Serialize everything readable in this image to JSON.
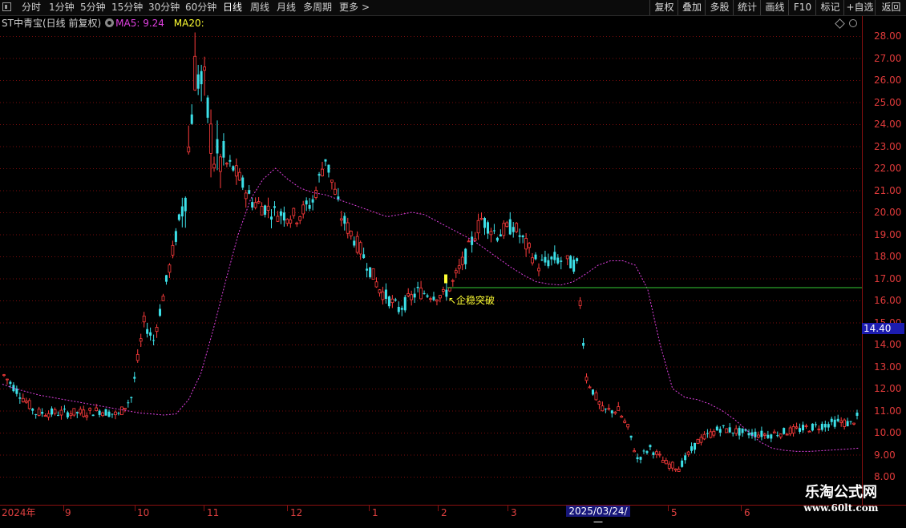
{
  "toolbar": {
    "periods": [
      "分时",
      "1分钟",
      "5分钟",
      "15分钟",
      "30分钟",
      "60分钟",
      "日线",
      "周线",
      "月线",
      "多周期",
      "更多"
    ],
    "active_period": "日线",
    "more_arrow": ">",
    "right_buttons": [
      "复权",
      "叠加",
      "多股",
      "统计",
      "画线",
      "F10",
      "标记",
      "+自选",
      "返回"
    ]
  },
  "info": {
    "title": "ST中青宝(日线 前复权)",
    "ma5_label": "MA5: 9.24",
    "ma20_label": "MA20:"
  },
  "colors": {
    "up": "#ff3c3c",
    "down": "#3ce0e8",
    "ma5": "#ffffff",
    "ma20": "#e040e0",
    "grid": "#7a0c0c",
    "signal_line": "#33cc33",
    "annotation": "#ffff33"
  },
  "price_axis": {
    "labels": [
      "28.00",
      "27.00",
      "26.00",
      "25.00",
      "24.00",
      "23.00",
      "22.00",
      "21.00",
      "20.00",
      "19.00",
      "18.00",
      "17.00",
      "16.00",
      "15.00",
      "14.00",
      "13.00",
      "12.00",
      "11.00",
      "10.00",
      "9.00",
      "8.00"
    ],
    "current_price_tag": "14.40"
  },
  "date_axis": {
    "labels": [
      "2024年",
      "9",
      "10",
      "11",
      "12",
      "1",
      "2",
      "3",
      "5",
      "6"
    ],
    "crosshair_date": "2025/03/24/一"
  },
  "annotation": "↖企稳突破",
  "watermark": {
    "line1": "乐淘公式网",
    "line2": "www.60lt.com"
  },
  "chart_data": {
    "type": "candlestick",
    "title": "ST中青宝(日线 前复权)",
    "ylim": [
      7.9,
      28.4
    ],
    "ma5_value": 9.24,
    "signal_level": 16.6,
    "signal_label": "企稳突破",
    "current_price": 14.4,
    "x_range": [
      "2024-08",
      "2025-06"
    ],
    "series": [
      {
        "name": "MA20",
        "values": [
          12.2,
          12.0,
          11.85,
          11.7,
          11.6,
          11.5,
          11.4,
          11.3,
          11.2,
          11.1,
          11.0,
          10.9,
          10.85,
          10.8,
          10.85,
          11.5,
          12.7,
          14.7,
          16.9,
          19.0,
          20.6,
          21.5,
          22.0,
          21.5,
          21.1,
          20.9,
          20.8,
          20.6,
          20.4,
          20.2,
          20.0,
          19.8,
          19.9,
          20.0,
          19.9,
          19.6,
          19.3,
          19.0,
          18.7,
          18.3,
          17.9,
          17.5,
          17.15,
          16.85,
          16.75,
          16.7,
          16.85,
          17.2,
          17.6,
          17.8,
          17.8,
          17.6,
          16.5,
          14.0,
          12.0,
          11.6,
          11.5,
          11.3,
          11.0,
          10.6,
          10.1,
          9.6,
          9.3,
          9.2,
          9.15,
          9.15,
          9.18,
          9.22,
          9.25,
          9.3
        ]
      }
    ]
  }
}
